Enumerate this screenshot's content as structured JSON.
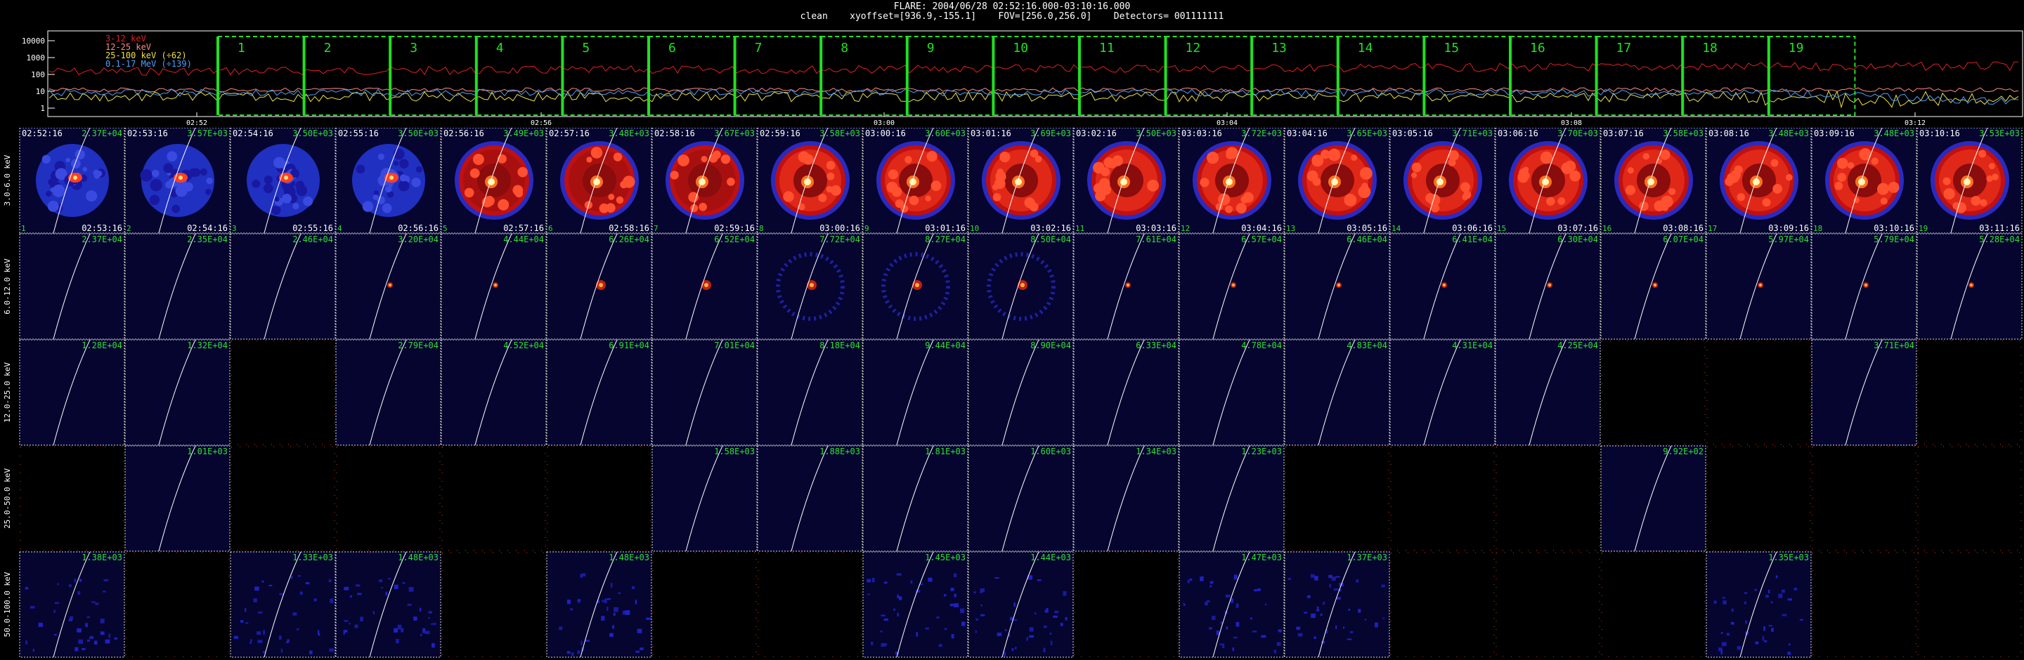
{
  "header": {
    "line1": "FLARE: 2004/06/28 02:52:16.000-03:10:16.000",
    "line2": "clean    xyoffset=[936.9,-155.1]    FOV=[256.0,256.0]    Detectors= 001111111"
  },
  "lightcurve": {
    "y_ticks": [
      "10000",
      "1000",
      "100",
      "10",
      "1"
    ],
    "x_ticks": [
      "02:52",
      "02:56",
      "03:00",
      "03:04",
      "03:08",
      "03:12"
    ],
    "legend": [
      {
        "label": "3-12 keV",
        "color": "#e02020"
      },
      {
        "label": "12-25 keV",
        "color": "#ff8a80"
      },
      {
        "label": "25-100 keV (÷62)",
        "color": "#f0e040"
      },
      {
        "label": "0.1-17 MeV (÷139)",
        "color": "#4aa0ff"
      }
    ],
    "intervals": [
      "1",
      "2",
      "3",
      "4",
      "5",
      "6",
      "7",
      "8",
      "9",
      "10",
      "11",
      "12",
      "13",
      "14",
      "15",
      "16",
      "17",
      "18",
      "19"
    ],
    "interval_color": "#20e020"
  },
  "grid": {
    "rows": [
      {
        "label": "3.0-6.0 keV",
        "type": "full"
      },
      {
        "label": "6.0-12.0 keV",
        "type": "dot"
      },
      {
        "label": "12.0-25.0 keV",
        "type": "none"
      },
      {
        "label": "25.0-50.0 keV",
        "type": "none"
      },
      {
        "label": "50.0-100.0 keV",
        "type": "noise"
      }
    ],
    "start_times": [
      "02:52:16",
      "02:53:16",
      "02:54:16",
      "02:55:16",
      "02:56:16",
      "02:57:16",
      "02:58:16",
      "02:59:16",
      "03:00:16",
      "03:01:16",
      "03:02:16",
      "03:03:16",
      "03:04:16",
      "03:05:16",
      "03:06:16",
      "03:07:16",
      "03:08:16",
      "03:09:16",
      "03:10:16"
    ],
    "end_times": [
      "02:53:16",
      "02:54:16",
      "02:55:16",
      "02:56:16",
      "02:57:16",
      "02:58:16",
      "02:59:16",
      "03:00:16",
      "03:01:16",
      "03:02:16",
      "03:03:16",
      "03:04:16",
      "03:05:16",
      "03:06:16",
      "03:07:16",
      "03:08:16",
      "03:09:16",
      "03:10:16",
      "03:11:16"
    ],
    "frame_numbers": [
      "1",
      "2",
      "3",
      "4",
      "5",
      "6",
      "7",
      "8",
      "9",
      "10",
      "11",
      "12",
      "13",
      "14",
      "15",
      "16",
      "17",
      "18",
      "19"
    ],
    "row_values": [
      [
        "2.37E+04",
        "3.57E+03",
        "3.50E+03",
        "3.50E+03",
        "3.49E+03",
        "3.48E+03",
        "3.67E+03",
        "3.58E+03",
        "3.60E+03",
        "3.69E+03",
        "3.50E+03",
        "3.72E+03",
        "3.65E+03",
        "3.71E+03",
        "3.70E+03",
        "3.58E+03",
        "3.48E+03",
        "3.48E+03",
        "3.53E+03"
      ],
      [
        "2.37E+04",
        "2.35E+04",
        "2.46E+04",
        "3.20E+04",
        "4.44E+04",
        "6.26E+04",
        "6.52E+04",
        "7.72E+04",
        "8.27E+04",
        "8.50E+04",
        "7.61E+04",
        "6.57E+04",
        "6.46E+04",
        "6.41E+04",
        "6.30E+04",
        "6.07E+04",
        "5.97E+04",
        "5.79E+04",
        "5.28E+04"
      ],
      [
        "1.28E+04",
        "1.32E+04",
        "",
        "2.79E+04",
        "4.52E+04",
        "6.91E+04",
        "7.01E+04",
        "8.18E+04",
        "9.44E+04",
        "8.90E+04",
        "6.33E+04",
        "4.78E+04",
        "4.83E+04",
        "4.31E+04",
        "4.25E+04",
        "",
        "",
        "3.71E+04",
        ""
      ],
      [
        "",
        "1.01E+03",
        "",
        "",
        "",
        "",
        "1.58E+03",
        "1.88E+03",
        "1.81E+03",
        "1.60E+03",
        "1.34E+03",
        "1.23E+03",
        "",
        "",
        "",
        "9.92E+02",
        "",
        "",
        ""
      ],
      [
        "1.38E+03",
        "",
        "1.33E+03",
        "1.48E+03",
        "",
        "1.48E+03",
        "",
        "",
        "1.45E+03",
        "1.44E+03",
        "",
        "1.47E+03",
        "1.37E+03",
        "",
        "",
        "",
        "1.35E+03",
        "",
        ""
      ]
    ]
  }
}
